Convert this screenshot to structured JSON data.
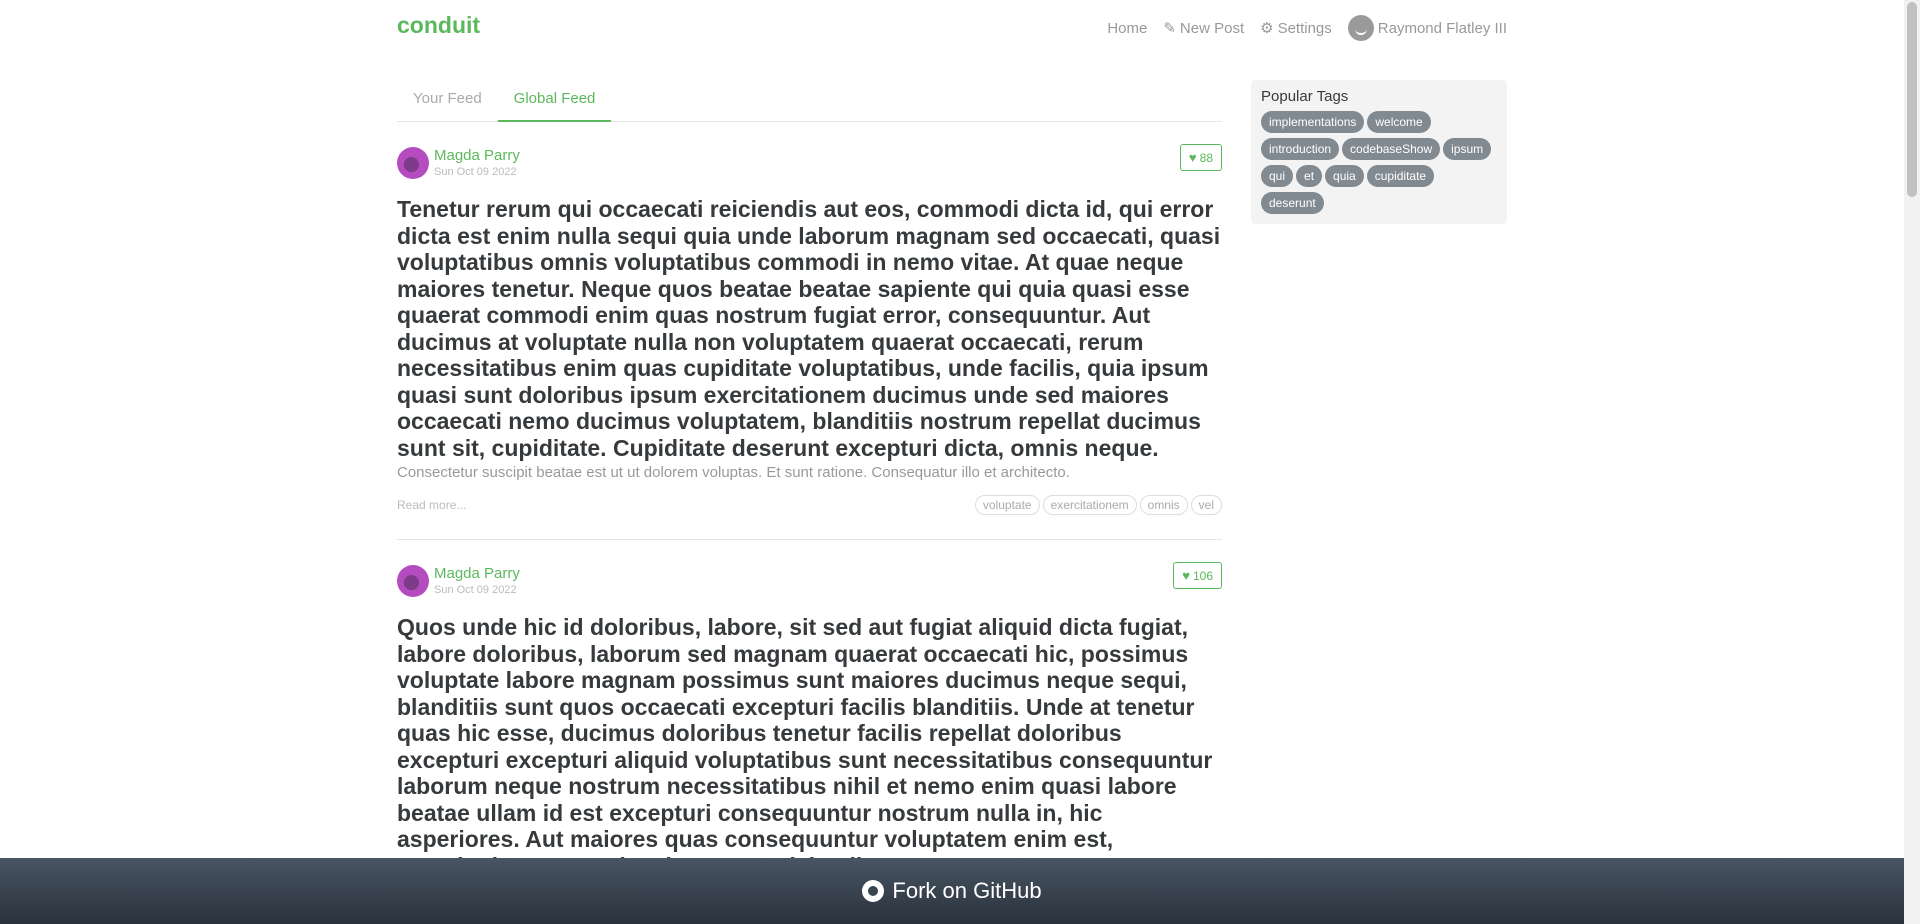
{
  "navbar": {
    "brand": "conduit",
    "links": [
      {
        "label": "Home",
        "icon": ""
      },
      {
        "label": "New Post",
        "icon": "edit-icon"
      },
      {
        "label": "Settings",
        "icon": "gear-icon"
      }
    ],
    "user": "Raymond Flatley III"
  },
  "feed": {
    "tabs": [
      "Your Feed",
      "Global Feed"
    ],
    "active_tab": "Global Feed"
  },
  "articles": [
    {
      "author": "Magda Parry",
      "date": "Sun Oct 09 2022",
      "favorites": "88",
      "title": "Tenetur rerum qui occaecati reiciendis aut eos, commodi dicta id, qui error dicta est enim nulla sequi quia unde laborum magnam sed occaecati, quasi voluptatibus omnis voluptatibus commodi in nemo vitae. At quae neque maiores tenetur. Neque quos beatae beatae sapiente qui quia quasi esse quaerat commodi enim quas nostrum fugiat error, consequuntur. Aut ducimus at voluptate nulla non voluptatem quaerat occaecati, rerum necessitatibus enim quas cupiditate voluptatibus, unde facilis, quia ipsum quasi sunt doloribus ipsum exercitationem ducimus unde sed maiores occaecati nemo ducimus voluptatem, blanditiis nostrum repellat ducimus sunt sit, cupiditate. Cupiditate deserunt excepturi dicta, omnis neque.",
      "description": "Consectetur suscipit beatae est ut ut dolorem voluptas. Et sunt ratione. Consequatur illo et architecto.",
      "read_more": "Read more...",
      "tags": [
        "voluptate",
        "exercitationem",
        "omnis",
        "vel"
      ]
    },
    {
      "author": "Magda Parry",
      "date": "Sun Oct 09 2022",
      "favorites": "106",
      "title": "Quos unde hic id doloribus, labore, sit sed aut fugiat aliquid dicta fugiat, labore doloribus, laborum sed magnam quaerat occaecati hic, possimus voluptate labore magnam possimus sunt maiores ducimus neque sequi, blanditiis sunt quos occaecati excepturi facilis blanditiis. Unde at tenetur quas hic esse, ducimus doloribus tenetur facilis repellat doloribus excepturi excepturi aliquid voluptatibus sunt necessitatibus consequuntur laborum neque nostrum necessitatibus nihil et nemo enim quasi labore beatae ullam id est excepturi consequuntur nostrum nulla in, hic asperiores. Aut maiores quas consequuntur voluptatem enim est, exercitationem quasi sed quaerat reiciendis consectetur"
    }
  ],
  "sidebar": {
    "title": "Popular Tags",
    "tags": [
      "implementations",
      "welcome",
      "introduction",
      "codebaseShow",
      "ipsum",
      "qui",
      "et",
      "quia",
      "cupiditate",
      "deserunt"
    ]
  },
  "footer": {
    "label": "Fork on GitHub"
  },
  "colors": {
    "accent": "#5cb85c",
    "tag_bg": "#818a91",
    "footer_bg": "#485563"
  }
}
